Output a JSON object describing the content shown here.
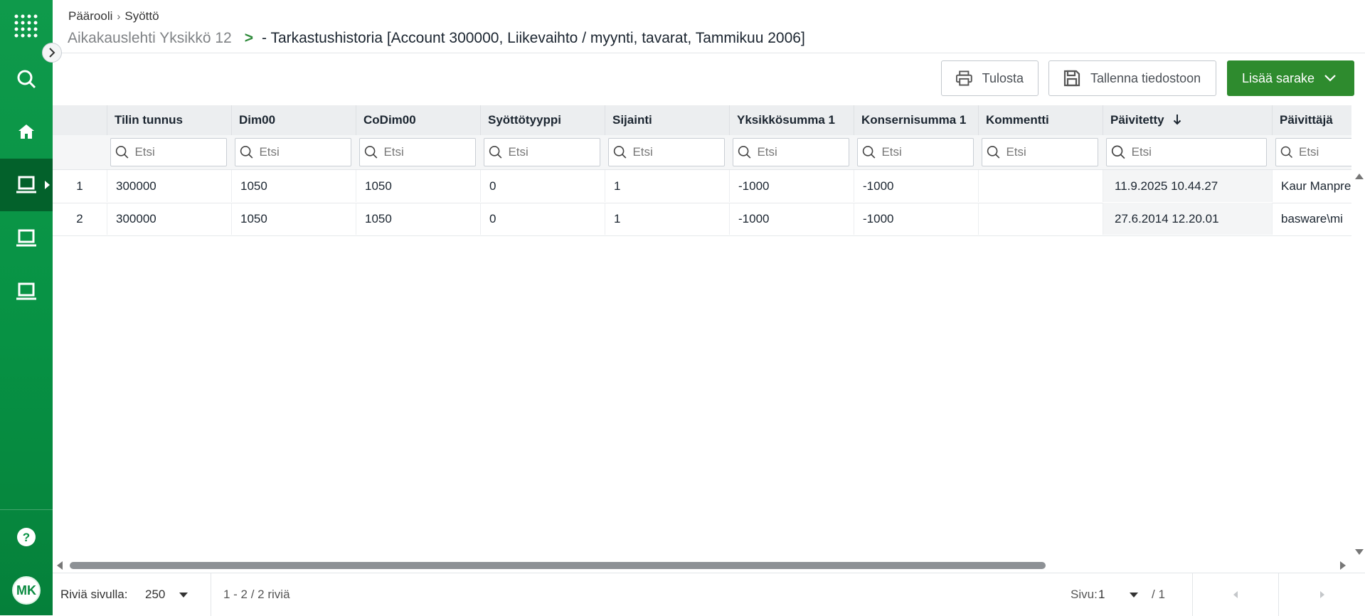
{
  "breadcrumb": {
    "root": "Päärooli",
    "separator": "›",
    "current": "Syöttö"
  },
  "title": {
    "parent": "Aikakauslehti Yksikkö 12",
    "arrow": ">",
    "main": "- Tarkastushistoria [Account 300000, Liikevaihto / myynti, tavarat, Tammikuu 2006]"
  },
  "sidebar": {
    "items": [
      {
        "name": "apps-grid-icon"
      },
      {
        "name": "search-icon"
      },
      {
        "name": "home-icon"
      },
      {
        "name": "laptop-icon",
        "active": true
      },
      {
        "name": "laptop-icon"
      },
      {
        "name": "laptop-icon"
      }
    ],
    "help_icon": "question-icon",
    "avatar_initials": "MK",
    "accent": "#079244"
  },
  "toolbar": {
    "print_label": "Tulosta",
    "save_label": "Tallenna tiedostoon",
    "add_column_label": "Lisää sarake",
    "primary_color": "#2e8b2e"
  },
  "grid": {
    "filter_placeholder": "Etsi",
    "columns": [
      {
        "label": "Tilin tunnus"
      },
      {
        "label": "Dim00"
      },
      {
        "label": "CoDim00"
      },
      {
        "label": "Syöttötyyppi"
      },
      {
        "label": "Sijainti"
      },
      {
        "label": "Yksikkösumma 1"
      },
      {
        "label": "Konsernisumma 1"
      },
      {
        "label": "Kommentti"
      },
      {
        "label": "Päivitetty",
        "sort": "descending"
      },
      {
        "label": "Päivittäjä"
      }
    ],
    "rows": [
      {
        "num": "1",
        "cells": [
          "300000",
          "1050",
          "1050",
          "0",
          "1",
          "-1000",
          "-1000",
          "",
          "11.9.2025 10.44.27",
          "Kaur Manpre"
        ]
      },
      {
        "num": "2",
        "cells": [
          "300000",
          "1050",
          "1050",
          "0",
          "1",
          "-1000",
          "-1000",
          "",
          "27.6.2014 12.20.01",
          "basware\\mi"
        ]
      }
    ]
  },
  "footer": {
    "rows_per_page_label": "Riviä sivulla:",
    "rows_per_page_value": "250",
    "range_text": "1 - 2 / 2 riviä",
    "page_label": "Sivu:",
    "page_value": "1",
    "page_total": "/ 1"
  }
}
